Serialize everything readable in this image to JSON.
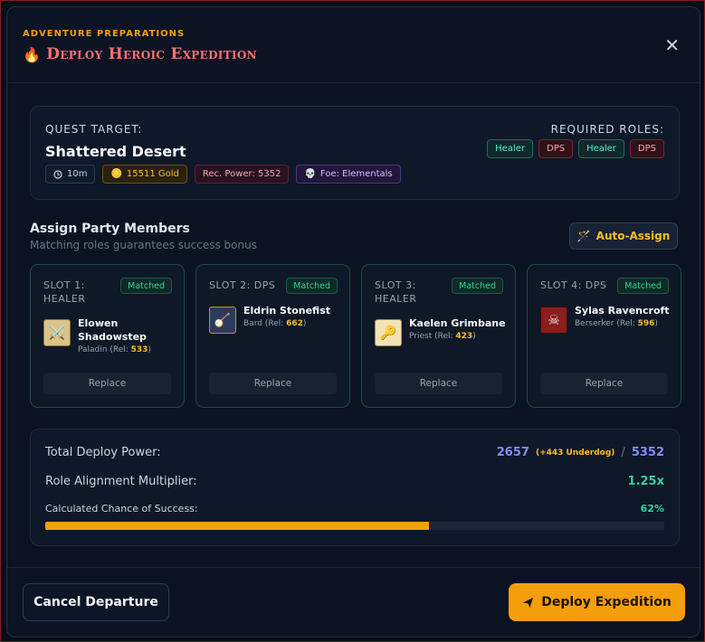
{
  "header": {
    "eyebrow": "ADVENTURE PREPARATIONS",
    "title": "Deploy Heroic Expedition",
    "close": "✕"
  },
  "quest": {
    "label": "QUEST TARGET:",
    "name": "Shattered Desert",
    "tags": {
      "time": "10m",
      "gold": "15511 Gold",
      "power": "Rec. Power: 5352",
      "foe": "Foe: Elementals"
    },
    "roles_label": "REQUIRED ROLES:",
    "roles": [
      "Healer",
      "DPS",
      "Healer",
      "DPS"
    ]
  },
  "assign": {
    "title": "Assign Party Members",
    "subtitle": "Matching roles guarantees success bonus",
    "auto_label": "Auto-Assign"
  },
  "slots": [
    {
      "label": "SLOT 1: HEALER",
      "badge": "Matched",
      "name": "Elowen Shadowstep",
      "cls": "Paladin",
      "rel": "533",
      "replace": "Replace",
      "icon": "crossed-swords-icon"
    },
    {
      "label": "SLOT 2: DPS",
      "badge": "Matched",
      "name": "Eldrin Stonefist",
      "cls": "Bard",
      "rel": "662",
      "replace": "Replace",
      "icon": "lute-icon"
    },
    {
      "label": "SLOT 3: HEALER",
      "badge": "Matched",
      "name": "Kaelen Grimbane",
      "cls": "Priest",
      "rel": "423",
      "replace": "Replace",
      "icon": "holy-scepter-icon"
    },
    {
      "label": "SLOT 4: DPS",
      "badge": "Matched",
      "name": "Sylas Ravencroft",
      "cls": "Berserker",
      "rel": "596",
      "replace": "Replace",
      "icon": "beast-skull-icon"
    }
  ],
  "summary": {
    "power_label": "Total Deploy Power:",
    "power_value": "2657",
    "underdog": "(+443 Underdog)",
    "slash": "/",
    "power_target": "5352",
    "mult_label": "Role Alignment Multiplier:",
    "mult_value": "1.25x",
    "chance_label": "Calculated Chance of Success:",
    "chance_value": "62%",
    "chance_fraction": 0.62
  },
  "footer": {
    "cancel": "Cancel Departure",
    "deploy": "Deploy Expedition"
  },
  "colors": {
    "accent": "#f59e0b",
    "title": "#f87171",
    "success": "#34d399",
    "power": "#818cf8"
  }
}
